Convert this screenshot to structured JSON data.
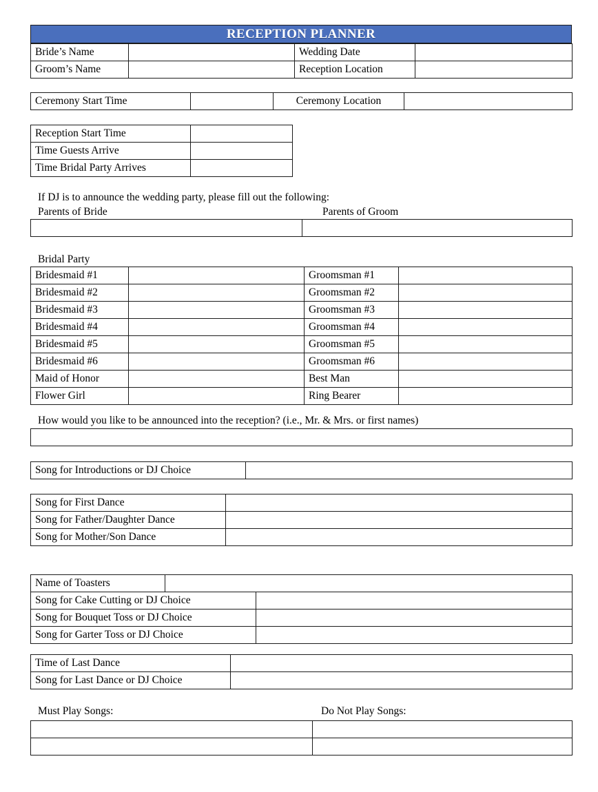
{
  "title": "RECEPTION PLANNER",
  "colors": {
    "banner": "#4a6fbd",
    "shaded_cell": "#bed2ea",
    "border": "#1a1a1a",
    "banner_text": "#ffffff"
  },
  "names_table": {
    "rows": [
      {
        "label_left": "Bride’s Name",
        "value_left": "",
        "label_right": "Wedding Date",
        "value_right": ""
      },
      {
        "label_left": "Groom’s Name",
        "value_left": "",
        "label_right": "Reception Location",
        "value_right": ""
      }
    ]
  },
  "ceremony_table": {
    "rows": [
      {
        "label_left": "Ceremony Start Time",
        "value_left": "",
        "label_right": "Ceremony Location",
        "value_right": ""
      }
    ]
  },
  "times_table": {
    "rows": [
      {
        "label": "Reception Start Time",
        "value": ""
      },
      {
        "label": "Time Guests Arrive",
        "value": ""
      },
      {
        "label": "Time Bridal Party Arrives",
        "value": ""
      }
    ]
  },
  "dj_note": "If DJ is to announce the wedding party, please fill out the following:",
  "parents": {
    "label_bride": "Parents of Bride",
    "label_groom": "Parents of Groom",
    "value_bride": "",
    "value_groom": ""
  },
  "bridal_party_heading": "Bridal Party",
  "bridal_party": {
    "rows": [
      {
        "label_left": "Bridesmaid #1",
        "value_left": "",
        "label_right": "Groomsman #1",
        "value_right": ""
      },
      {
        "label_left": "Bridesmaid #2",
        "value_left": "",
        "label_right": "Groomsman #2",
        "value_right": ""
      },
      {
        "label_left": "Bridesmaid #3",
        "value_left": "",
        "label_right": "Groomsman #3",
        "value_right": ""
      },
      {
        "label_left": "Bridesmaid #4",
        "value_left": "",
        "label_right": "Groomsman #4",
        "value_right": ""
      },
      {
        "label_left": "Bridesmaid #5",
        "value_left": "",
        "label_right": "Groomsman #5",
        "value_right": ""
      },
      {
        "label_left": "Bridesmaid #6",
        "value_left": "",
        "label_right": "Groomsman #6",
        "value_right": ""
      },
      {
        "label_left": "Maid of Honor",
        "value_left": "",
        "label_right": "Best Man",
        "value_right": ""
      },
      {
        "label_left": "Flower Girl",
        "value_left": "",
        "label_right": "Ring Bearer",
        "value_right": ""
      }
    ]
  },
  "announcement_question": "How would you like to be announced into the reception?  (i.e., Mr. & Mrs. or first names)",
  "announcement_value": "",
  "intro_song": {
    "label": "Song for Introductions or DJ Choice",
    "value": ""
  },
  "dance_songs": {
    "rows": [
      {
        "label": "Song for First Dance",
        "value": ""
      },
      {
        "label": "Song for Father/Daughter Dance",
        "value": ""
      },
      {
        "label": "Song for Mother/Son Dance",
        "value": ""
      }
    ]
  },
  "toasters": {
    "label": "Name of Toasters",
    "value": ""
  },
  "event_songs": {
    "rows": [
      {
        "label": "Song for Cake Cutting or DJ Choice",
        "value": ""
      },
      {
        "label": "Song for Bouquet Toss or DJ Choice",
        "value": ""
      },
      {
        "label": "Song for Garter Toss or DJ Choice",
        "value": ""
      }
    ]
  },
  "last_dance": {
    "rows": [
      {
        "label": "Time of Last Dance",
        "value": ""
      },
      {
        "label": "Song for Last Dance or DJ Choice",
        "value": ""
      }
    ]
  },
  "playlists": {
    "must_play_label": "Must Play Songs:",
    "do_not_play_label": "Do Not Play Songs:",
    "rows": [
      {
        "must": "",
        "donot": ""
      },
      {
        "must": "",
        "donot": ""
      }
    ]
  }
}
